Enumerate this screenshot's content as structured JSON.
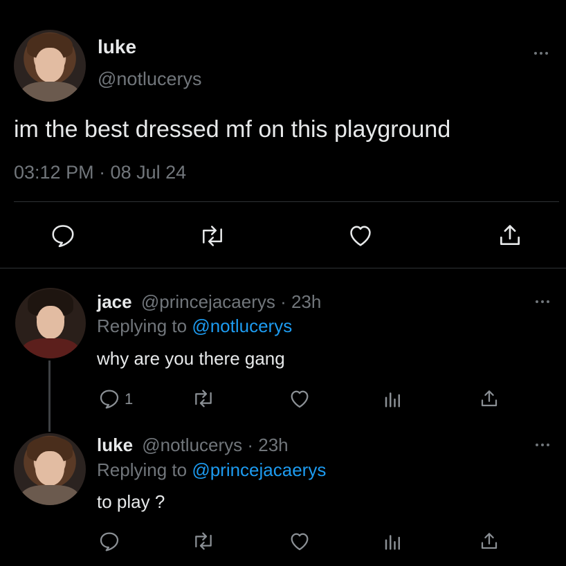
{
  "main_tweet": {
    "display_name": "luke",
    "handle": "@notlucerys",
    "text": "im the best dressed mf on this playground",
    "timestamp": "03:12 PM · 08 Jul 24"
  },
  "replies": [
    {
      "display_name": "jace",
      "handle_time": "@princejacaerys · 23h",
      "replying_to_label": "Replying to",
      "replying_to_handle": "@notlucerys",
      "text": "why are you there gang",
      "reply_count": "1"
    },
    {
      "display_name": "luke",
      "handle_time": "@notlucerys · 23h",
      "replying_to_label": "Replying to",
      "replying_to_handle": "@princejacaerys",
      "text": "to play ?",
      "reply_count": ""
    }
  ],
  "icons": {
    "reply": "reply-icon",
    "retweet": "retweet-icon",
    "like": "heart-icon",
    "views": "views-icon",
    "share": "share-icon",
    "more": "more-icon"
  },
  "colors": {
    "background": "#000000",
    "text": "#e7e9ea",
    "secondary": "#71767b",
    "link": "#1d9bf0"
  }
}
